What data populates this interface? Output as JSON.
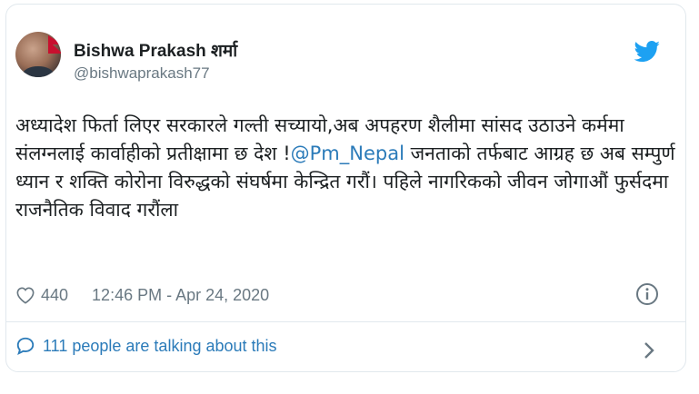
{
  "tweet": {
    "author_name": "Bishwa Prakash शर्मा",
    "author_handle": "@bishwaprakash77",
    "text_before": "अध्यादेश फिर्ता लिएर सरकारले गल्ती सच्यायो,अब अपहरण शैलीमा सांसद उठाउने कर्ममा संलग्नलाई कार्वाहीको प्रतीक्षामा छ देश !",
    "mention": "@Pm_Nepal",
    "text_after": " जनताको तर्फबाट आग्रह छ अब सम्पुर्ण ध्यान र शक्ति कोरोना विरुद्धको संघर्षमा केन्द्रित गरौं। पहिले नागरिकको जीवन जोगाऔं फुर्सदमा राजनैतिक विवाद गरौंला",
    "likes": "440",
    "timestamp": "12:46 PM - Apr 24, 2020",
    "discussion": "111 people are talking about this"
  },
  "icons": {
    "logo": "twitter-bird-icon",
    "like": "heart-icon",
    "info": "info-icon",
    "reply": "speech-bubble-icon",
    "more": "chevron-right-icon"
  },
  "colors": {
    "brand": "#1da1f2",
    "link": "#2b7bb9",
    "muted": "#697882",
    "text": "#1c2022",
    "border": "#e1e8ed"
  }
}
